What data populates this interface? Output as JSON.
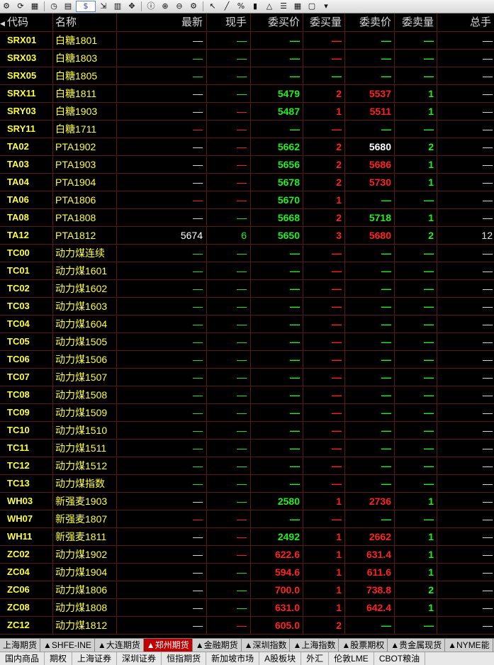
{
  "toolbar": {
    "icons": [
      "settings-icon",
      "refresh-icon",
      "layout-icon",
      "clock-icon",
      "document-icon",
      "dollar-icon",
      "export-icon",
      "table-icon",
      "move-icon",
      "info-icon",
      "zoom-in-icon",
      "zoom-out-icon",
      "gear-icon",
      "cursor-icon",
      "line-icon",
      "percent-icon",
      "bar-icon",
      "triangle-icon",
      "list-icon",
      "grid-icon",
      "window-icon",
      "chevron-icon"
    ],
    "dollar_label": "$"
  },
  "columns": {
    "code": "代码",
    "name": "名称",
    "last": "最新",
    "vol": "现手",
    "bid": "委买价",
    "bidv": "委买量",
    "ask": "委卖价",
    "askv": "委卖量",
    "tot": "总手"
  },
  "rows": [
    {
      "code": "SRX01",
      "name": "白糖1801",
      "last": "—",
      "vol": "—",
      "bid": "—",
      "bidv": "—",
      "ask": "—",
      "askv": "—",
      "tot": "—",
      "lc": "dash-w",
      "vc": "green",
      "bc": "green",
      "bvc": "red",
      "ac": "green",
      "avc": "green"
    },
    {
      "code": "SRX03",
      "name": "白糖1803",
      "last": "—",
      "vol": "—",
      "bid": "—",
      "bidv": "—",
      "ask": "—",
      "askv": "—",
      "tot": "—",
      "lc": "green",
      "vc": "green",
      "bc": "green",
      "bvc": "red",
      "ac": "green",
      "avc": "green"
    },
    {
      "code": "SRX05",
      "name": "白糖1805",
      "last": "—",
      "vol": "—",
      "bid": "—",
      "bidv": "—",
      "ask": "—",
      "askv": "—",
      "tot": "—",
      "lc": "green",
      "vc": "green",
      "bc": "green",
      "bvc": "green",
      "ac": "green",
      "avc": "green"
    },
    {
      "code": "SRX11",
      "name": "白糖1811",
      "last": "—",
      "vol": "—",
      "bid": "5479",
      "bidv": "2",
      "ask": "5537",
      "askv": "1",
      "tot": "—",
      "lc": "dash-w",
      "vc": "green",
      "bc": "green",
      "bvc": "red",
      "ac": "red",
      "avc": "green"
    },
    {
      "code": "SRY03",
      "name": "白糖1903",
      "last": "—",
      "vol": "—",
      "bid": "5487",
      "bidv": "1",
      "ask": "5511",
      "askv": "1",
      "tot": "—",
      "lc": "dash-w",
      "vc": "red",
      "bc": "green",
      "bvc": "red",
      "ac": "red",
      "avc": "green"
    },
    {
      "code": "SRY11",
      "name": "白糖1711",
      "last": "—",
      "vol": "—",
      "bid": "—",
      "bidv": "—",
      "ask": "—",
      "askv": "—",
      "tot": "—",
      "lc": "red",
      "vc": "red",
      "bc": "green",
      "bvc": "red",
      "ac": "green",
      "avc": "green"
    },
    {
      "code": "TA02",
      "name": "PTA1902",
      "last": "—",
      "vol": "—",
      "bid": "5662",
      "bidv": "2",
      "ask": "5680",
      "askv": "2",
      "tot": "—",
      "lc": "dash-w",
      "vc": "red",
      "bc": "green",
      "bvc": "red",
      "ac": "white",
      "avc": "green"
    },
    {
      "code": "TA03",
      "name": "PTA1903",
      "last": "—",
      "vol": "—",
      "bid": "5656",
      "bidv": "2",
      "ask": "5686",
      "askv": "1",
      "tot": "—",
      "lc": "dash-w",
      "vc": "red",
      "bc": "green",
      "bvc": "red",
      "ac": "red",
      "avc": "green"
    },
    {
      "code": "TA04",
      "name": "PTA1904",
      "last": "—",
      "vol": "—",
      "bid": "5678",
      "bidv": "2",
      "ask": "5730",
      "askv": "1",
      "tot": "—",
      "lc": "dash-w",
      "vc": "red",
      "bc": "green",
      "bvc": "red",
      "ac": "red",
      "avc": "green"
    },
    {
      "code": "TA06",
      "name": "PTA1806",
      "last": "—",
      "vol": "—",
      "bid": "5670",
      "bidv": "1",
      "ask": "—",
      "askv": "—",
      "tot": "—",
      "lc": "red",
      "vc": "red",
      "bc": "green",
      "bvc": "red",
      "ac": "green",
      "avc": "green"
    },
    {
      "code": "TA08",
      "name": "PTA1808",
      "last": "—",
      "vol": "—",
      "bid": "5668",
      "bidv": "2",
      "ask": "5718",
      "askv": "1",
      "tot": "—",
      "lc": "dash-w",
      "vc": "green",
      "bc": "green",
      "bvc": "red",
      "ac": "green",
      "avc": "green"
    },
    {
      "code": "TA12",
      "name": "PTA1812",
      "last": "5674",
      "vol": "6",
      "bid": "5650",
      "bidv": "3",
      "ask": "5680",
      "askv": "2",
      "tot": "12",
      "lc": "white",
      "vc": "green",
      "bc": "green",
      "bvc": "red",
      "ac": "red",
      "avc": "green"
    },
    {
      "code": "TC00",
      "name": "动力煤连续",
      "last": "—",
      "vol": "—",
      "bid": "—",
      "bidv": "—",
      "ask": "—",
      "askv": "—",
      "tot": "—",
      "lc": "green",
      "vc": "green",
      "bc": "green",
      "bvc": "red",
      "ac": "green",
      "avc": "green"
    },
    {
      "code": "TC01",
      "name": "动力煤1601",
      "last": "—",
      "vol": "—",
      "bid": "—",
      "bidv": "—",
      "ask": "—",
      "askv": "—",
      "tot": "—",
      "lc": "green",
      "vc": "green",
      "bc": "green",
      "bvc": "red",
      "ac": "green",
      "avc": "green"
    },
    {
      "code": "TC02",
      "name": "动力煤1602",
      "last": "—",
      "vol": "—",
      "bid": "—",
      "bidv": "—",
      "ask": "—",
      "askv": "—",
      "tot": "—",
      "lc": "green",
      "vc": "green",
      "bc": "green",
      "bvc": "red",
      "ac": "green",
      "avc": "green"
    },
    {
      "code": "TC03",
      "name": "动力煤1603",
      "last": "—",
      "vol": "—",
      "bid": "—",
      "bidv": "—",
      "ask": "—",
      "askv": "—",
      "tot": "—",
      "lc": "green",
      "vc": "green",
      "bc": "green",
      "bvc": "red",
      "ac": "green",
      "avc": "green"
    },
    {
      "code": "TC04",
      "name": "动力煤1604",
      "last": "—",
      "vol": "—",
      "bid": "—",
      "bidv": "—",
      "ask": "—",
      "askv": "—",
      "tot": "—",
      "lc": "green",
      "vc": "green",
      "bc": "green",
      "bvc": "red",
      "ac": "green",
      "avc": "green"
    },
    {
      "code": "TC05",
      "name": "动力煤1505",
      "last": "—",
      "vol": "—",
      "bid": "—",
      "bidv": "—",
      "ask": "—",
      "askv": "—",
      "tot": "—",
      "lc": "green",
      "vc": "green",
      "bc": "green",
      "bvc": "red",
      "ac": "green",
      "avc": "green"
    },
    {
      "code": "TC06",
      "name": "动力煤1506",
      "last": "—",
      "vol": "—",
      "bid": "—",
      "bidv": "—",
      "ask": "—",
      "askv": "—",
      "tot": "—",
      "lc": "green",
      "vc": "green",
      "bc": "green",
      "bvc": "red",
      "ac": "green",
      "avc": "green"
    },
    {
      "code": "TC07",
      "name": "动力煤1507",
      "last": "—",
      "vol": "—",
      "bid": "—",
      "bidv": "—",
      "ask": "—",
      "askv": "—",
      "tot": "—",
      "lc": "green",
      "vc": "green",
      "bc": "green",
      "bvc": "red",
      "ac": "green",
      "avc": "green"
    },
    {
      "code": "TC08",
      "name": "动力煤1508",
      "last": "—",
      "vol": "—",
      "bid": "—",
      "bidv": "—",
      "ask": "—",
      "askv": "—",
      "tot": "—",
      "lc": "green",
      "vc": "green",
      "bc": "green",
      "bvc": "red",
      "ac": "green",
      "avc": "green"
    },
    {
      "code": "TC09",
      "name": "动力煤1509",
      "last": "—",
      "vol": "—",
      "bid": "—",
      "bidv": "—",
      "ask": "—",
      "askv": "—",
      "tot": "—",
      "lc": "green",
      "vc": "green",
      "bc": "green",
      "bvc": "red",
      "ac": "green",
      "avc": "green"
    },
    {
      "code": "TC10",
      "name": "动力煤1510",
      "last": "—",
      "vol": "—",
      "bid": "—",
      "bidv": "—",
      "ask": "—",
      "askv": "—",
      "tot": "—",
      "lc": "green",
      "vc": "green",
      "bc": "green",
      "bvc": "red",
      "ac": "green",
      "avc": "green"
    },
    {
      "code": "TC11",
      "name": "动力煤1511",
      "last": "—",
      "vol": "—",
      "bid": "—",
      "bidv": "—",
      "ask": "—",
      "askv": "—",
      "tot": "—",
      "lc": "green",
      "vc": "green",
      "bc": "green",
      "bvc": "red",
      "ac": "green",
      "avc": "green"
    },
    {
      "code": "TC12",
      "name": "动力煤1512",
      "last": "—",
      "vol": "—",
      "bid": "—",
      "bidv": "—",
      "ask": "—",
      "askv": "—",
      "tot": "—",
      "lc": "green",
      "vc": "green",
      "bc": "green",
      "bvc": "red",
      "ac": "green",
      "avc": "green"
    },
    {
      "code": "TC13",
      "name": "动力煤指数",
      "last": "—",
      "vol": "—",
      "bid": "—",
      "bidv": "—",
      "ask": "—",
      "askv": "—",
      "tot": "—",
      "lc": "green",
      "vc": "green",
      "bc": "green",
      "bvc": "red",
      "ac": "green",
      "avc": "green"
    },
    {
      "code": "WH03",
      "name": "新强麦1903",
      "last": "—",
      "vol": "—",
      "bid": "2580",
      "bidv": "1",
      "ask": "2736",
      "askv": "1",
      "tot": "—",
      "lc": "dash-w",
      "vc": "green",
      "bc": "green",
      "bvc": "red",
      "ac": "red",
      "avc": "green"
    },
    {
      "code": "WH07",
      "name": "新强麦1807",
      "last": "—",
      "vol": "—",
      "bid": "—",
      "bidv": "—",
      "ask": "—",
      "askv": "—",
      "tot": "—",
      "lc": "red",
      "vc": "red",
      "bc": "green",
      "bvc": "red",
      "ac": "green",
      "avc": "green"
    },
    {
      "code": "WH11",
      "name": "新强麦1811",
      "last": "—",
      "vol": "—",
      "bid": "2492",
      "bidv": "1",
      "ask": "2662",
      "askv": "1",
      "tot": "—",
      "lc": "dash-w",
      "vc": "red",
      "bc": "green",
      "bvc": "red",
      "ac": "red",
      "avc": "green"
    },
    {
      "code": "ZC02",
      "name": "动力煤1902",
      "last": "—",
      "vol": "—",
      "bid": "622.6",
      "bidv": "1",
      "ask": "631.4",
      "askv": "1",
      "tot": "—",
      "lc": "dash-w",
      "vc": "red",
      "bc": "red",
      "bvc": "red",
      "ac": "red",
      "avc": "green"
    },
    {
      "code": "ZC04",
      "name": "动力煤1904",
      "last": "—",
      "vol": "—",
      "bid": "594.6",
      "bidv": "1",
      "ask": "611.6",
      "askv": "1",
      "tot": "—",
      "lc": "dash-w",
      "vc": "green",
      "bc": "red",
      "bvc": "red",
      "ac": "red",
      "avc": "green"
    },
    {
      "code": "ZC06",
      "name": "动力煤1806",
      "last": "—",
      "vol": "—",
      "bid": "700.0",
      "bidv": "1",
      "ask": "738.8",
      "askv": "2",
      "tot": "—",
      "lc": "dash-w",
      "vc": "green",
      "bc": "red",
      "bvc": "red",
      "ac": "red",
      "avc": "green"
    },
    {
      "code": "ZC08",
      "name": "动力煤1808",
      "last": "—",
      "vol": "—",
      "bid": "631.0",
      "bidv": "1",
      "ask": "642.4",
      "askv": "1",
      "tot": "—",
      "lc": "dash-w",
      "vc": "green",
      "bc": "red",
      "bvc": "red",
      "ac": "red",
      "avc": "green"
    },
    {
      "code": "ZC12",
      "name": "动力煤1812",
      "last": "—",
      "vol": "—",
      "bid": "605.0",
      "bidv": "2",
      "ask": "—",
      "askv": "—",
      "tot": "—",
      "lc": "dash-w",
      "vc": "red",
      "bc": "red",
      "bvc": "red",
      "ac": "green",
      "avc": "green"
    }
  ],
  "tabs": [
    "上海期货",
    "▲SHFE-INE",
    "▲大连期货",
    "▲郑州期货",
    "▲金融期货",
    "▲深圳指数",
    "▲上海指数",
    "▲股票期权",
    "▲贵金属现货",
    "▲NYME能"
  ],
  "active_tab": 3,
  "bottom_bar": [
    "国内商品",
    "期权",
    "上海证券",
    "深圳证券",
    "恒指期货",
    "新加坡市场",
    "A股板块",
    "外汇",
    "伦敦LME",
    "CBOT粮油"
  ],
  "colors": {
    "green": "#22ee22",
    "red": "#ff2222",
    "yellow": "#ffff33",
    "grid": "#5a1a1a",
    "active_tab": "#c00000"
  }
}
